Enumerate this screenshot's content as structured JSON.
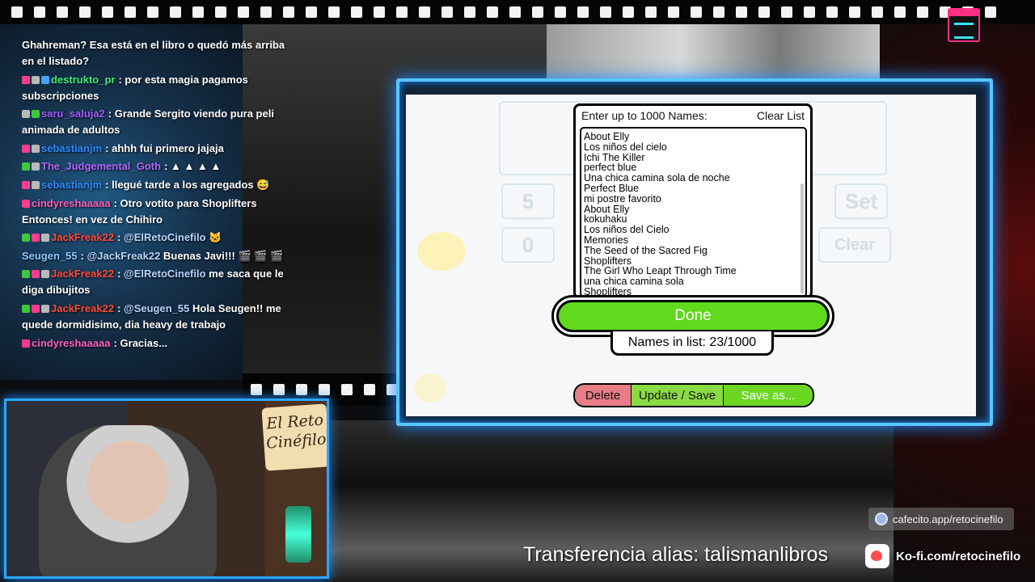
{
  "chat": [
    {
      "name": "",
      "name_color": "#ffffff",
      "badges": [],
      "text": "Ghahreman? Esa está en el libro o quedó más arriba en el listado?"
    },
    {
      "name": "destrukto_pr",
      "name_color": "#3df07a",
      "badges": [
        "b-pink",
        "b-gray",
        "b-blue"
      ],
      "text": "por esta magia pagamos subscripciones"
    },
    {
      "name": "saru_saluja2",
      "name_color": "#a15cff",
      "badges": [
        "b-gray",
        "b-green"
      ],
      "text": "Grande Sergito viendo pura peli animada de adultos"
    },
    {
      "name": "sebastianjm",
      "name_color": "#2e8bff",
      "badges": [
        "b-pink",
        "b-gray"
      ],
      "text": "ahhh fui primero jajaja"
    },
    {
      "name": "The_Judgemental_Goth",
      "name_color": "#b266ff",
      "badges": [
        "b-green",
        "b-gray"
      ],
      "text": "▲ ▲ ▲ ▲"
    },
    {
      "name": "sebastianjm",
      "name_color": "#2e8bff",
      "badges": [
        "b-pink",
        "b-gray"
      ],
      "text": "llegué tarde a los agregados 😅"
    },
    {
      "name": "cindyreshaaaaa",
      "name_color": "#ff5fc0",
      "badges": [
        "b-pink"
      ],
      "text": "Otro votito para Shoplifters Entonces! en vez de Chihiro"
    },
    {
      "name": "JackFreak22",
      "name_color": "#ff4a3d",
      "badges": [
        "b-green",
        "b-pink",
        "b-gray"
      ],
      "mention": "@ElRetoCinefilo",
      "text": "🐱"
    },
    {
      "name": "Seugen_55",
      "name_color": "#8cc8ff",
      "badges": [],
      "mention": "@JackFreak22",
      "text": "Buenas Javi!!! 🎬 🎬 🎬"
    },
    {
      "name": "JackFreak22",
      "name_color": "#ff4a3d",
      "badges": [
        "b-green",
        "b-pink",
        "b-gray"
      ],
      "mention": "@ElRetoCinefilo",
      "text": "me saca que le diga dibujitos"
    },
    {
      "name": "JackFreak22",
      "name_color": "#ff4a3d",
      "badges": [
        "b-green",
        "b-pink",
        "b-gray"
      ],
      "mention": "@Seugen_55",
      "text": "Hola Seugen!! me quede dormidisimo, dia heavy de trabajo"
    },
    {
      "name": "cindyreshaaaaa",
      "name_color": "#ff5fc0",
      "badges": [
        "b-pink"
      ],
      "text": "Gracias..."
    }
  ],
  "webcam": {
    "sign_text": "El Reto Cinéfilo"
  },
  "wheel": {
    "ghost_set": "Set",
    "ghost_clear": "Clear",
    "ghost_5": "5",
    "ghost_0": "0",
    "panel_title": "Enter up to 1000 Names:",
    "clear_list": "Clear List",
    "names": [
      "About Elly",
      "Los niños del cielo",
      "Ichi The Killer",
      "perfect blue",
      "Una chica camina sola de noche",
      "Perfect Blue",
      "mi postre favorito",
      "About Elly",
      "kokuhaku",
      "Los niños del Cielo",
      "Memories",
      "The Seed of the Sacred Fig",
      "Shoplifters",
      "The Girl Who Leapt Through Time",
      "una chica camina sola",
      "Shoplifters"
    ],
    "done_label": "Done",
    "count_label": "Names in list: 23/1000",
    "delete_label": "Delete",
    "update_label": "Update / Save",
    "saveas_label": "Save as..."
  },
  "overlays": {
    "cafecito": "cafecito.app/retocinefilo",
    "alias": "Transferencia alias: talismanlibros",
    "kofi": "Ko-fi.com/retocinefilo"
  },
  "colors": {
    "done_green": "#61d91c",
    "frame_blue": "#58c6ff",
    "delete_red": "#e77d86"
  }
}
